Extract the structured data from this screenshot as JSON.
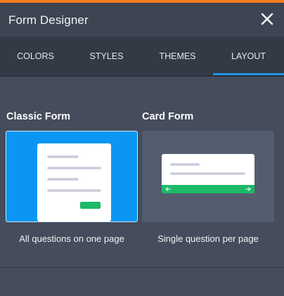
{
  "window": {
    "title": "Form Designer",
    "close_icon": "close-icon"
  },
  "colors": {
    "accent_top": "#f47c20",
    "active_tab_underline": "#2196e8",
    "classic_selected_bg": "#0a96f2",
    "card_button_green": "#1db968"
  },
  "tabs": [
    {
      "label": "COLORS",
      "active": false
    },
    {
      "label": "STYLES",
      "active": false
    },
    {
      "label": "THEMES",
      "active": false
    },
    {
      "label": "LAYOUT",
      "active": true
    }
  ],
  "layouts": [
    {
      "title": "Classic Form",
      "caption": "All questions on one page",
      "selected": true,
      "preview_icon": "classic-form-preview"
    },
    {
      "title": "Card Form",
      "caption": "Single question per page",
      "selected": false,
      "preview_icon": "card-form-preview",
      "nav_icons": [
        "arrow-left-icon",
        "arrow-right-icon"
      ]
    }
  ]
}
